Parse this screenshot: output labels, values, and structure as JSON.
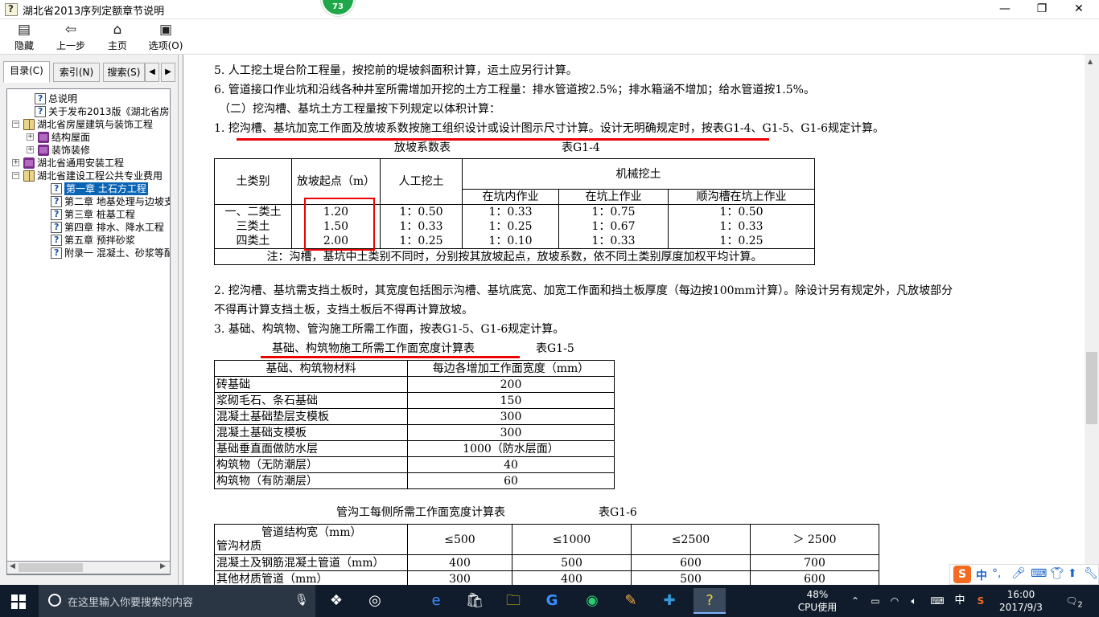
{
  "window": {
    "title": "湖北省2013序列定额章节说明",
    "badge": "73",
    "minimize": "—",
    "restore": "❐",
    "close": "✕"
  },
  "toolbar": {
    "hide": "隐藏",
    "back": "上一步",
    "home": "主页",
    "options": "选项(O)"
  },
  "tabs": {
    "contents": "目录(C)",
    "index": "索引(N)",
    "search": "搜索(S)",
    "left": "◀",
    "right": "▶"
  },
  "tree": [
    {
      "label": "总说明",
      "type": "page"
    },
    {
      "label": "关于发布2013版《湖北省房屋",
      "type": "page"
    },
    {
      "label": "湖北省房屋建筑与装饰工程",
      "type": "openbook",
      "toggle": "−"
    },
    {
      "label": "结构屋面",
      "type": "book",
      "toggle": "+"
    },
    {
      "label": "装饰装修",
      "type": "book",
      "toggle": "+"
    },
    {
      "label": "湖北省通用安装工程",
      "type": "book",
      "toggle": "+"
    },
    {
      "label": "湖北省建设工程公共专业费用",
      "type": "openbook",
      "toggle": "−"
    },
    {
      "label": "第一章 土石方工程",
      "type": "page",
      "selected": true
    },
    {
      "label": "第二章 地基处理与边坡支",
      "type": "page"
    },
    {
      "label": "第三章 桩基工程",
      "type": "page"
    },
    {
      "label": "第四章 排水、降水工程",
      "type": "page"
    },
    {
      "label": "第五章 预拌砂浆",
      "type": "page"
    },
    {
      "label": "附录一 混凝土、砂浆等配",
      "type": "page"
    }
  ],
  "content": {
    "p5": "5. 人工挖土堤台阶工程量，按挖前的堤坡斜面积计算，运土应另行计算。",
    "p6": "6. 管道接口作业坑和沿线各种井室所需增加开挖的土方工程量：排水管道按2.5%；排水箱涵不增加；给水管道按1.5%。",
    "p_sec2": "（二）挖沟槽、基坑土方工程量按下列规定以体积计算：",
    "p1": "1. 挖沟槽、基坑加宽工作面及放坡系数按施工组织设计或设计图示尺寸计算。设计无明确规定时，按表G1-4、G1-5、G1-6规定计算。",
    "p2a": "2. 挖沟槽、基坑需支挡土板时，其宽度包括图示沟槽、基坑底宽、加宽工作面和挡土板厚度（每边按100mm计算）。除设计另有规定外，凡放坡部分",
    "p2b": "不得再计算支挡土板，支挡土板后不得再计算放坡。",
    "p3": "3. 基础、构筑物、管沟施工所需工作面，按表G1-5、G1-6规定计算。"
  },
  "table_g14": {
    "caption": "放坡系数表",
    "code": "表G1-4",
    "h_soil": "土类别",
    "h_start": "放坡起点（m）",
    "h_manual": "人工挖土",
    "h_machine": "机械挖土",
    "h_pit_in": "在坑内作业",
    "h_pit_on": "在坑上作业",
    "h_along": "顺沟槽在坑上作业",
    "rows": [
      {
        "soil": "一、二类土",
        "start": "1.20",
        "manual": "1：0.50",
        "pit_in": "1：0.33",
        "pit_on": "1：0.75",
        "along": "1：0.50"
      },
      {
        "soil": "三类土",
        "start": "1.50",
        "manual": "1：0.33",
        "pit_in": "1：0.25",
        "pit_on": "1：0.67",
        "along": "1：0.33"
      },
      {
        "soil": "四类土",
        "start": "2.00",
        "manual": "1：0.25",
        "pit_in": "1：0.10",
        "pit_on": "1：0.33",
        "along": "1：0.25"
      }
    ],
    "note": "注：沟槽，基坑中土类别不同时，分别按其放坡起点，放坡系数，依不同土类别厚度加权平均计算。"
  },
  "table_g15": {
    "caption": "基础、构筑物施工所需工作面宽度计算表",
    "code": "表G1-5",
    "h_material": "基础、构筑物材料",
    "h_width": "每边各增加工作面宽度（mm）",
    "rows": [
      {
        "material": "砖基础",
        "width": "200"
      },
      {
        "material": "浆砌毛石、条石基础",
        "width": "150"
      },
      {
        "material": "混凝土基础垫层支模板",
        "width": "300"
      },
      {
        "material": "混凝土基础支模板",
        "width": "300"
      },
      {
        "material": "基础垂直面做防水层",
        "width": "1000（防水层面）"
      },
      {
        "material": "构筑物（无防潮层）",
        "width": "40"
      },
      {
        "material": "构筑物（有防潮层）",
        "width": "60"
      }
    ]
  },
  "table_g16": {
    "caption": "管沟工每侧所需工作面宽度计算表",
    "code": "表G1-6",
    "h_width": "管道结构宽（mm）",
    "h_material": "管沟材质",
    "cols": [
      "≤500",
      "≤1000",
      "≤2500",
      "＞ 2500"
    ],
    "rows": [
      {
        "material": "混凝土及钢筋混凝土管道（mm）",
        "v": [
          "400",
          "500",
          "600",
          "700"
        ]
      },
      {
        "material": "其他材质管道（mm）",
        "v": [
          "300",
          "400",
          "500",
          "600"
        ]
      }
    ]
  },
  "ime": {
    "logo": "S",
    "lang": "中",
    "punct": "°,"
  },
  "taskbar": {
    "search_placeholder": "在这里输入你要搜索的内容",
    "cpu_percent": "48%",
    "cpu_label": "CPU使用",
    "ime_lang": "中",
    "time": "16:00",
    "date": "2017/9/3",
    "notif_count": "2"
  }
}
